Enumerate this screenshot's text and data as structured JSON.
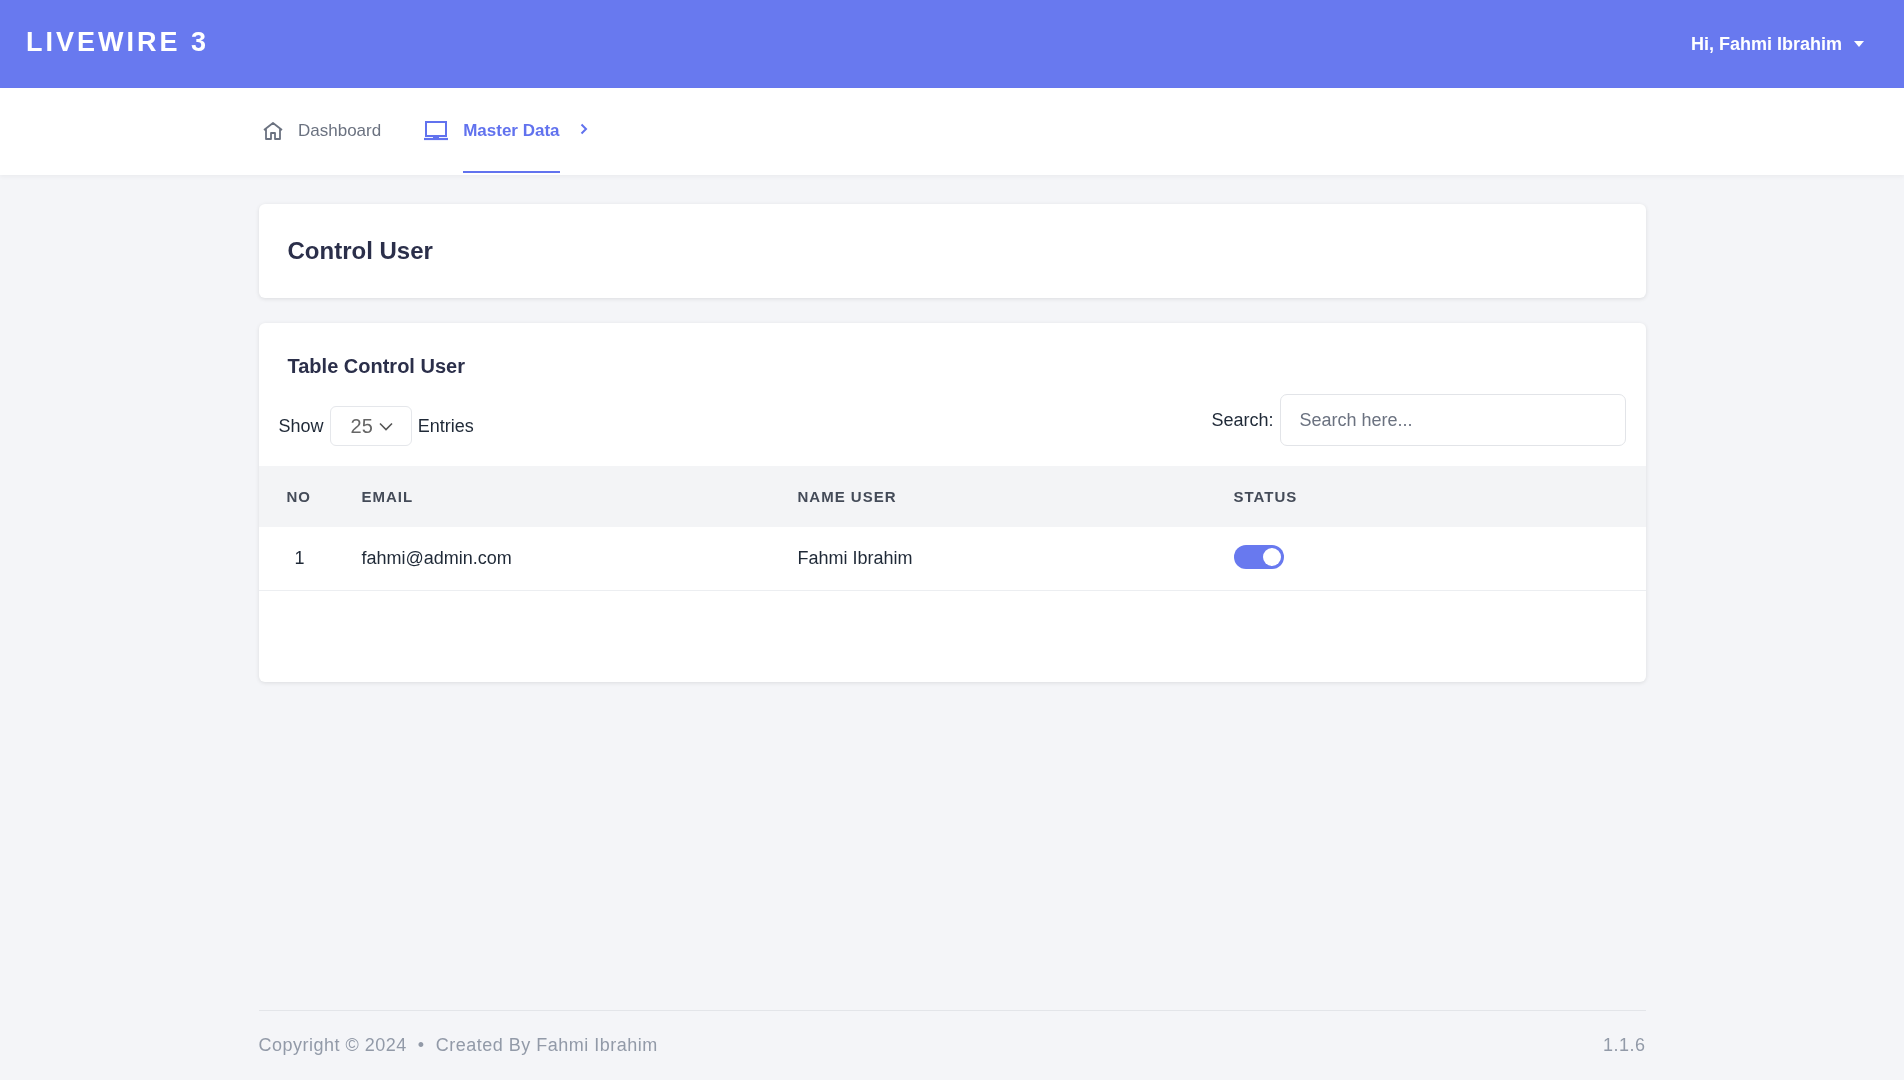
{
  "header": {
    "brand": "LIVEWIRE 3",
    "user_menu": "Hi, Fahmi Ibrahim"
  },
  "nav": [
    {
      "label": "Dashboard",
      "selected": false,
      "kind": "home",
      "has_submenu": false
    },
    {
      "label": "Master Data",
      "selected": true,
      "kind": "monitor",
      "has_submenu": true
    }
  ],
  "page_title": "Control User",
  "table_card": {
    "title": "Table Control User",
    "show_label": "Show",
    "page_size": "25",
    "entries_label": "Entries",
    "search_label": "Search:",
    "search_placeholder": "Search here...",
    "columns": [
      "NO",
      "EMAIL",
      "NAME USER",
      "STATUS"
    ],
    "rows": [
      {
        "no": "1",
        "email": "fahmi@admin.com",
        "name": "Fahmi Ibrahim",
        "on": true
      }
    ]
  },
  "footer": {
    "copyright": "Copyright © 2024  •  Created By Fahmi Ibrahim",
    "version": "1.1.6"
  }
}
